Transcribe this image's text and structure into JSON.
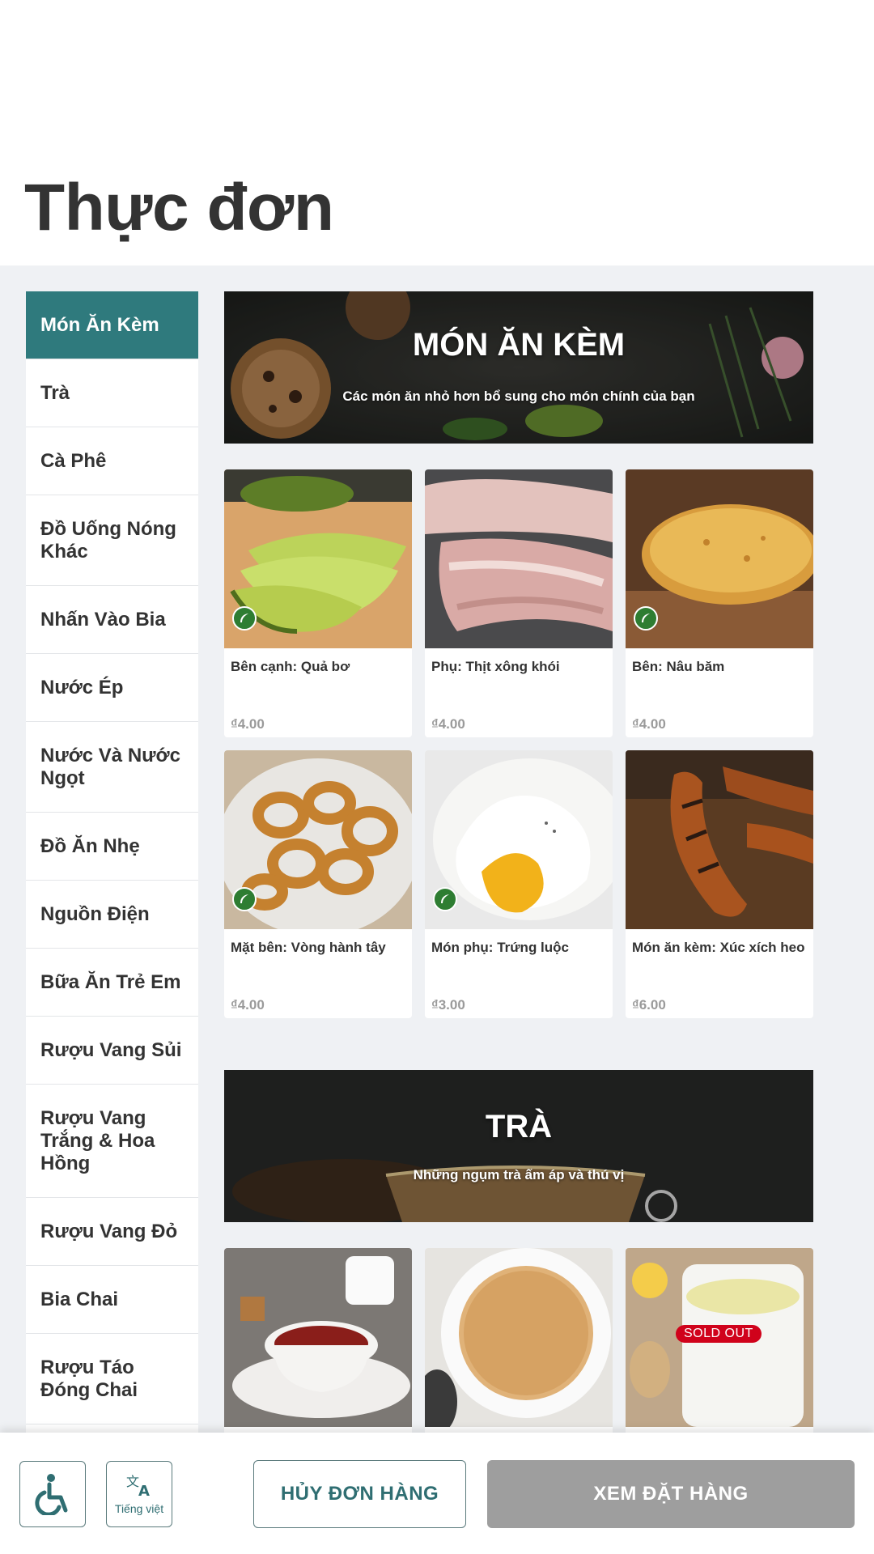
{
  "page": {
    "title": "Thực đơn"
  },
  "sidebar": {
    "items": [
      {
        "label": "Món Ăn Kèm",
        "active": true
      },
      {
        "label": "Trà"
      },
      {
        "label": "Cà Phê"
      },
      {
        "label": "Đồ Uống Nóng Khác"
      },
      {
        "label": "Nhấn Vào Bia"
      },
      {
        "label": "Nước Ép"
      },
      {
        "label": "Nước Và Nước Ngọt"
      },
      {
        "label": "Đồ Ăn Nhẹ"
      },
      {
        "label": "Nguồn Điện"
      },
      {
        "label": "Bữa Ăn Trẻ Em"
      },
      {
        "label": "Rượu Vang Sủi"
      },
      {
        "label": "Rượu Vang Trắng & Hoa Hồng"
      },
      {
        "label": "Rượu Vang Đỏ"
      },
      {
        "label": "Bia Chai"
      },
      {
        "label": "Rượu Táo Đóng Chai"
      }
    ]
  },
  "sections": [
    {
      "title": "MÓN ĂN KÈM",
      "subtitle": "Các món ăn nhỏ hơn bổ sung cho món chính của bạn",
      "items": [
        {
          "name": "Bên cạnh: Quả bơ",
          "price": "₫4.00",
          "vegetarian": true,
          "image": "avocado"
        },
        {
          "name": "Phụ: Thịt xông khói",
          "price": "₫4.00",
          "vegetarian": false,
          "image": "bacon"
        },
        {
          "name": "Bên: Nâu băm",
          "price": "₫4.00",
          "vegetarian": true,
          "image": "hash-brown"
        },
        {
          "name": "Mặt bên: Vòng hành tây",
          "price": "₫4.00",
          "vegetarian": true,
          "image": "onion-rings"
        },
        {
          "name": "Món phụ: Trứng luộc",
          "price": "₫3.00",
          "vegetarian": true,
          "image": "poached-egg"
        },
        {
          "name": "Món ăn kèm: Xúc xích heo",
          "price": "₫6.00",
          "vegetarian": false,
          "image": "sausage"
        }
      ]
    },
    {
      "title": "TRÀ",
      "subtitle": "Những ngụm trà ấm áp và thú vị",
      "items": [
        {
          "name": "",
          "price": "",
          "image": "tea-milk"
        },
        {
          "name": "",
          "price": "",
          "image": "milk-tea"
        },
        {
          "name": "",
          "price": "",
          "image": "lemon-ginger-tea",
          "badge": "SOLD OUT"
        }
      ]
    }
  ],
  "footer": {
    "accessibility_icon": "wheelchair-icon",
    "language_icon": "translate-icon",
    "language_label": "Tiếng việt",
    "cancel_label": "HỦY ĐƠN HÀNG",
    "view_label": "XEM ĐẶT HÀNG"
  },
  "colors": {
    "accent": "#2f7a7d",
    "disabled": "#9e9e9e",
    "soldout": "#d0021b",
    "veg": "#2e7d32"
  }
}
